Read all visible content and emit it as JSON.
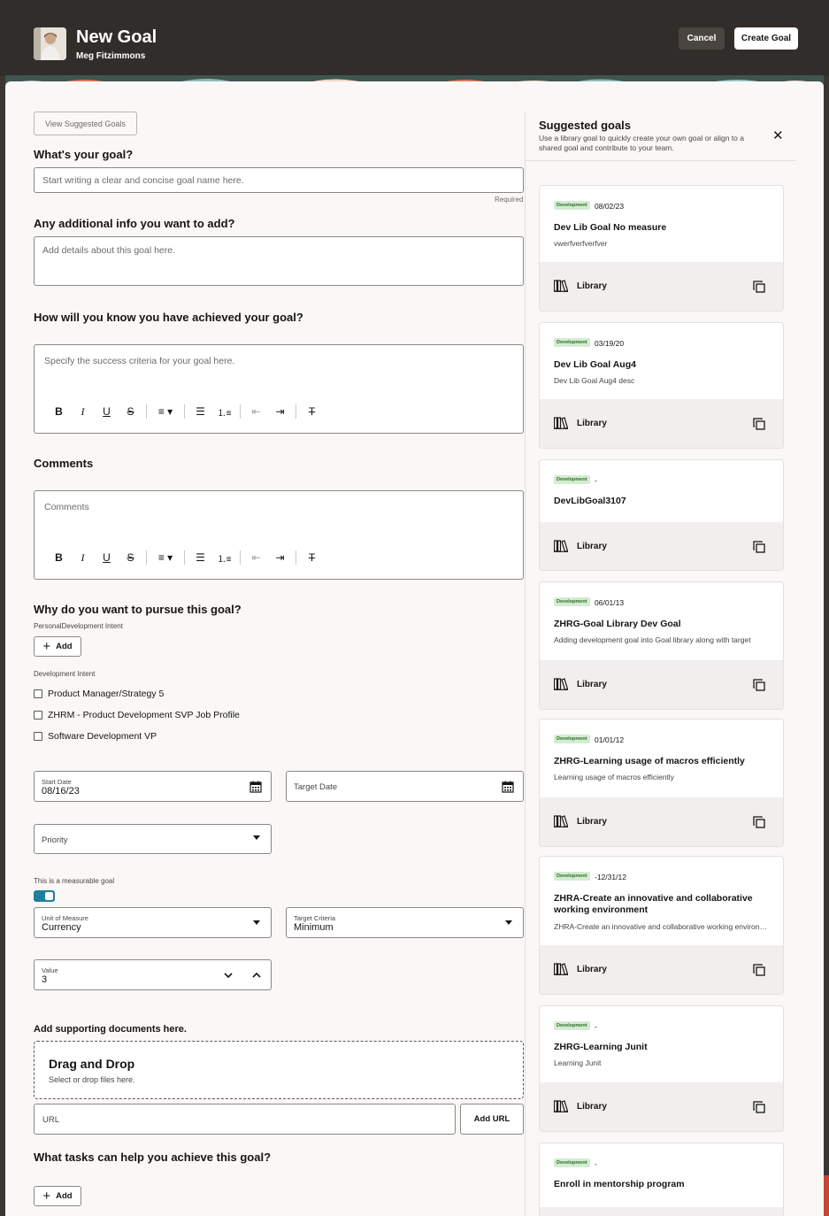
{
  "header": {
    "title": "New Goal",
    "user_name": "Meg Fitzimmons",
    "cancel_label": "Cancel",
    "create_label": "Create Goal"
  },
  "form": {
    "view_suggested_label": "View Suggested Goals",
    "goal_name": {
      "heading": "What's your goal?",
      "placeholder": "Start writing a clear and concise goal name here.",
      "required_label": "Required"
    },
    "additional_info": {
      "heading": "Any additional info you want to add?",
      "placeholder": "Add details about this goal here."
    },
    "success_criteria": {
      "heading": "How will you know you have achieved your goal?",
      "placeholder": "Specify the success criteria for your goal here."
    },
    "comments": {
      "heading": "Comments",
      "placeholder": "Comments"
    },
    "why": {
      "heading": "Why do you want to pursue this goal?",
      "personal_intent_label": "PersonalDevelopment Intent",
      "add_label": "Add",
      "development_intent_label": "Development Intent",
      "options": [
        "Product Manager/Strategy 5",
        "ZHRM - Product Development SVP Job Profile",
        "Software Development VP"
      ]
    },
    "start_date": {
      "label": "Start Date",
      "value": "08/16/23"
    },
    "target_date": {
      "label": "Target Date"
    },
    "priority": {
      "label": "Priority"
    },
    "measurable": {
      "label": "This is a measurable goal",
      "on": true
    },
    "unit_of_measure": {
      "label": "Unit of Measure",
      "value": "Currency"
    },
    "target_criteria": {
      "label": "Target Criteria",
      "value": "Minimum"
    },
    "value": {
      "label": "Value",
      "value": "3"
    },
    "documents": {
      "heading": "Add supporting documents here.",
      "drop_title": "Drag and Drop",
      "drop_subtitle": "Select or drop files here.",
      "url_placeholder": "URL",
      "add_url_label": "Add URL"
    },
    "tasks": {
      "heading": "What tasks can help you achieve this goal?",
      "add_label": "Add"
    }
  },
  "suggested": {
    "title": "Suggested goals",
    "description": "Use a library goal to quickly create your own goal or align to a shared goal and contribute to your team.",
    "library_label": "Library",
    "cards": [
      {
        "badge": "Development",
        "date": "08/02/23",
        "title": "Dev Lib Goal No measure",
        "desc": "vwerfverfverfver"
      },
      {
        "badge": "Development",
        "date": "03/19/20",
        "title": "Dev Lib Goal Aug4",
        "desc": "Dev Lib Goal Aug4 desc"
      },
      {
        "badge": "Development",
        "date": "-",
        "title": "DevLibGoal3107",
        "desc": ""
      },
      {
        "badge": "Development",
        "date": "06/01/13",
        "title": "ZHRG-Goal Library Dev Goal",
        "desc": "Adding development goal into Goal library along with target"
      },
      {
        "badge": "Development",
        "date": "01/01/12",
        "title": "ZHRG-Learning usage of macros efficiently",
        "desc": "Learning usage of macros efficiently"
      },
      {
        "badge": "Development",
        "date": "-12/31/12",
        "title": "ZHRA-Create an innovative and collaborative working environment",
        "desc": "ZHRA-Create an innovative and collaborative working environment"
      },
      {
        "badge": "Development",
        "date": "-",
        "title": "ZHRG-Learning Junit",
        "desc": "Learning Junit"
      },
      {
        "badge": "Development",
        "date": "-",
        "title": "Enroll in mentorship program",
        "desc": ""
      }
    ]
  }
}
